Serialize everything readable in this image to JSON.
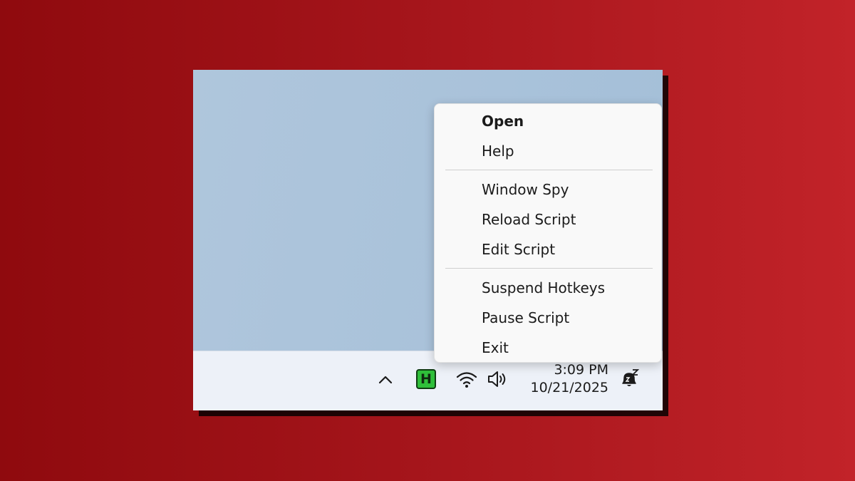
{
  "colors": {
    "background_left": "#8f0a0e",
    "background_right": "#c22329",
    "desktop": "#a9c2da",
    "taskbar": "#edf1f8",
    "menu_bg": "#f9f9f9",
    "ahk_icon_green": "#2fbf3a"
  },
  "context_menu": {
    "items": [
      {
        "label": "Open",
        "bold": true
      },
      {
        "label": "Help"
      },
      {
        "separator": true
      },
      {
        "label": "Window Spy"
      },
      {
        "label": "Reload Script"
      },
      {
        "label": "Edit Script"
      },
      {
        "separator": true
      },
      {
        "label": "Suspend Hotkeys"
      },
      {
        "label": "Pause Script"
      },
      {
        "label": "Exit"
      }
    ]
  },
  "taskbar": {
    "tray_icons": [
      "chevron-up-icon",
      "autohotkey-icon",
      "wifi-icon",
      "volume-icon"
    ],
    "ahk_icon_letter": "H",
    "time": "3:09 PM",
    "date": "10/21/2025",
    "notification_icon": "bell-snooze-icon"
  }
}
